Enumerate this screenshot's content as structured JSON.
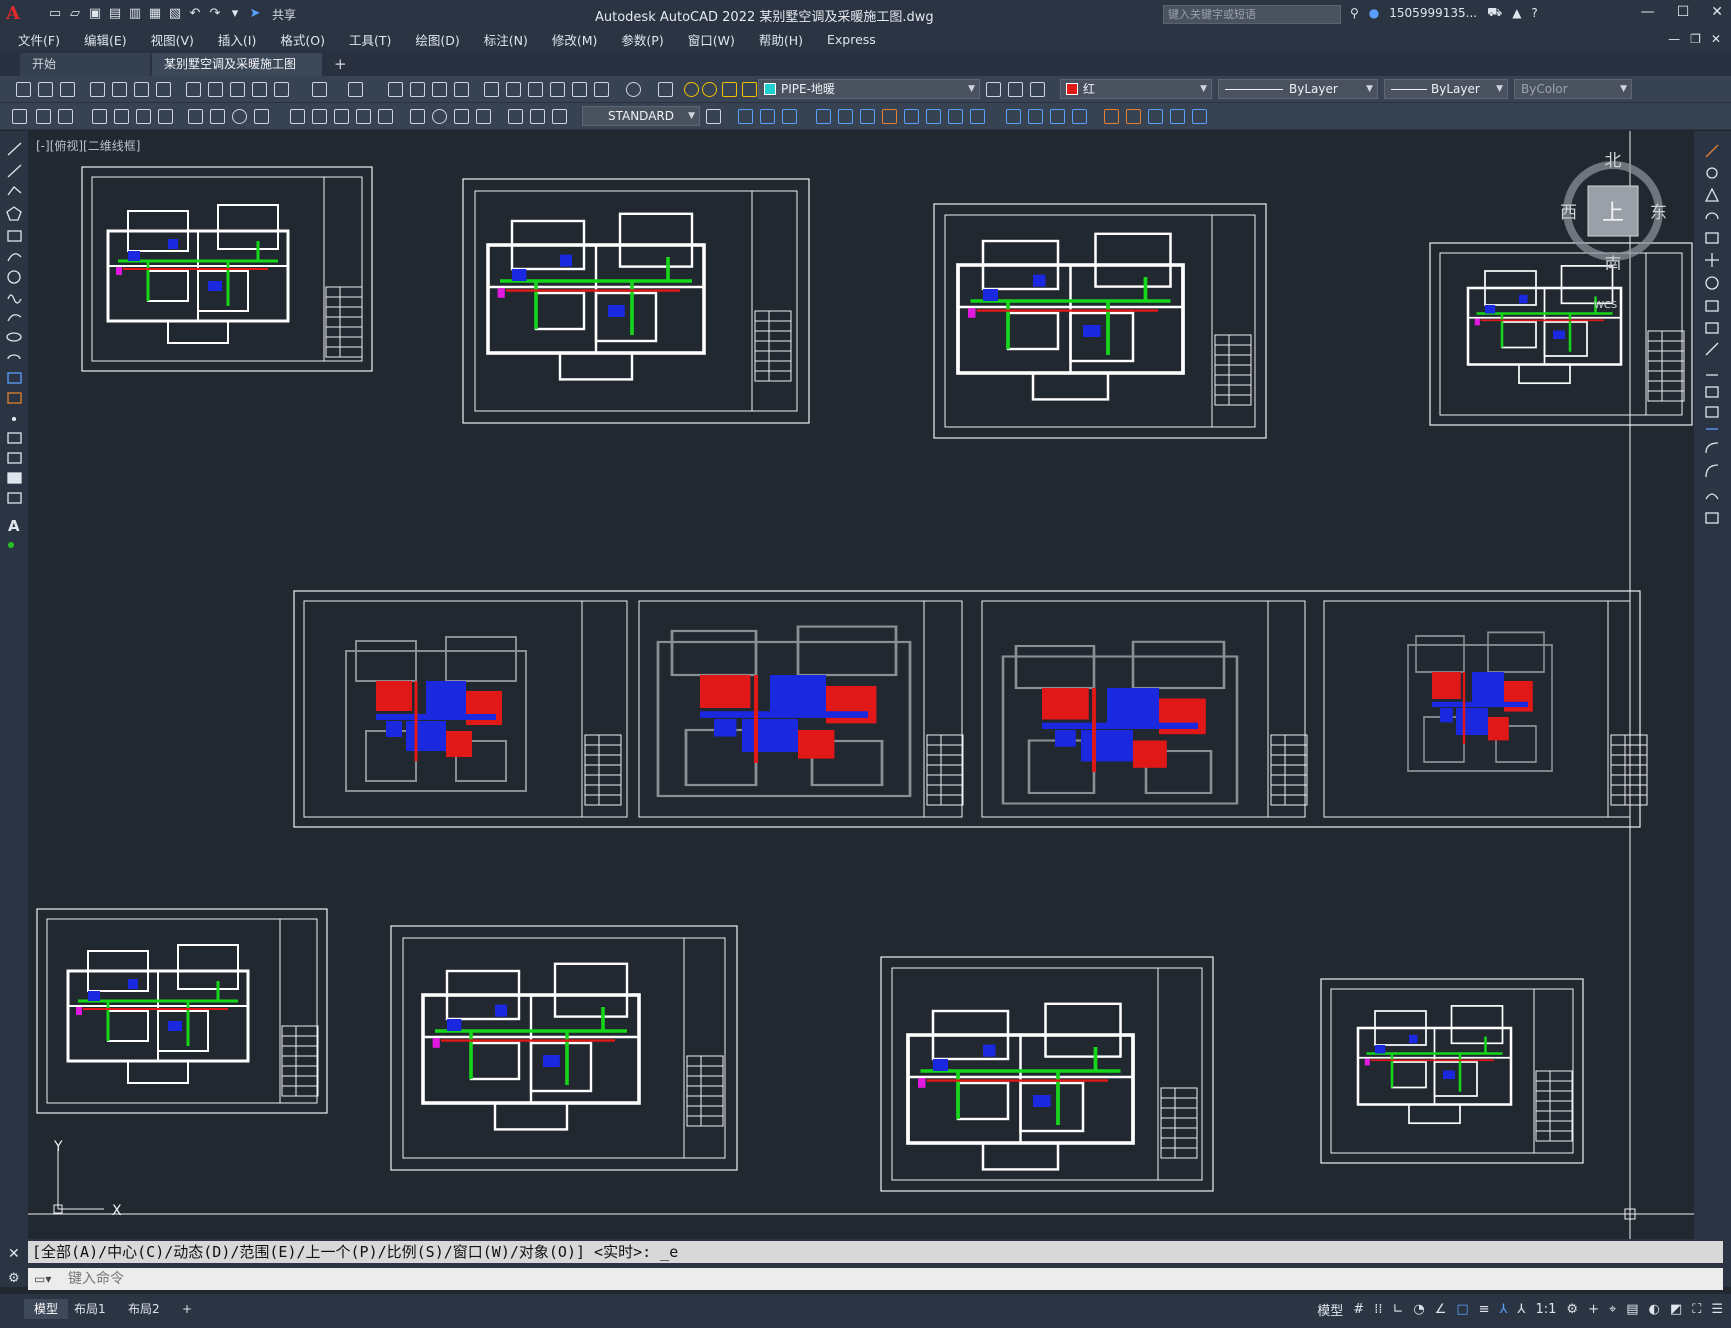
{
  "app": {
    "title": "Autodesk AutoCAD 2022    某别墅空调及采暖施工图.dwg",
    "share_label": "共享",
    "search_placeholder": "键入关键字或短语",
    "user": "1505999135...",
    "logo_letter": "A"
  },
  "menu": {
    "items": [
      "文件(F)",
      "编辑(E)",
      "视图(V)",
      "插入(I)",
      "格式(O)",
      "工具(T)",
      "绘图(D)",
      "标注(N)",
      "修改(M)",
      "参数(P)",
      "窗口(W)",
      "帮助(H)",
      "Express"
    ]
  },
  "tabs": {
    "start": "开始",
    "document": "某别墅空调及采暖施工图*",
    "add": "+"
  },
  "toolbar": {
    "layer": "PIPE-地暖",
    "color": "红",
    "linetype": "ByLayer",
    "lineweight": "ByLayer",
    "plotstyle": "ByColor",
    "textstyle": "STANDARD"
  },
  "viewport": {
    "label": "[-][俯视][二维线框]",
    "compass": {
      "north": "北",
      "south": "南",
      "east": "东",
      "west": "西",
      "top": "上",
      "wcs": "WCS"
    },
    "ucs": {
      "x": "X",
      "y": "Y"
    }
  },
  "command": {
    "history": "[全部(A)/中心(C)/动态(D)/范围(E)/上一个(P)/比例(S)/窗口(W)/对象(O)] <实时>: _e",
    "placeholder": "键入命令"
  },
  "status": {
    "layouts": [
      "模型",
      "布局1",
      "布局2"
    ],
    "add": "+",
    "model_label": "模型",
    "scale": "1:1"
  },
  "colors": {
    "accent_red": "#e01818",
    "pipe_blue": "#1a28e0",
    "pipe_green": "#16d61a",
    "canvas": "#212830",
    "magenta": "#e018e0"
  }
}
